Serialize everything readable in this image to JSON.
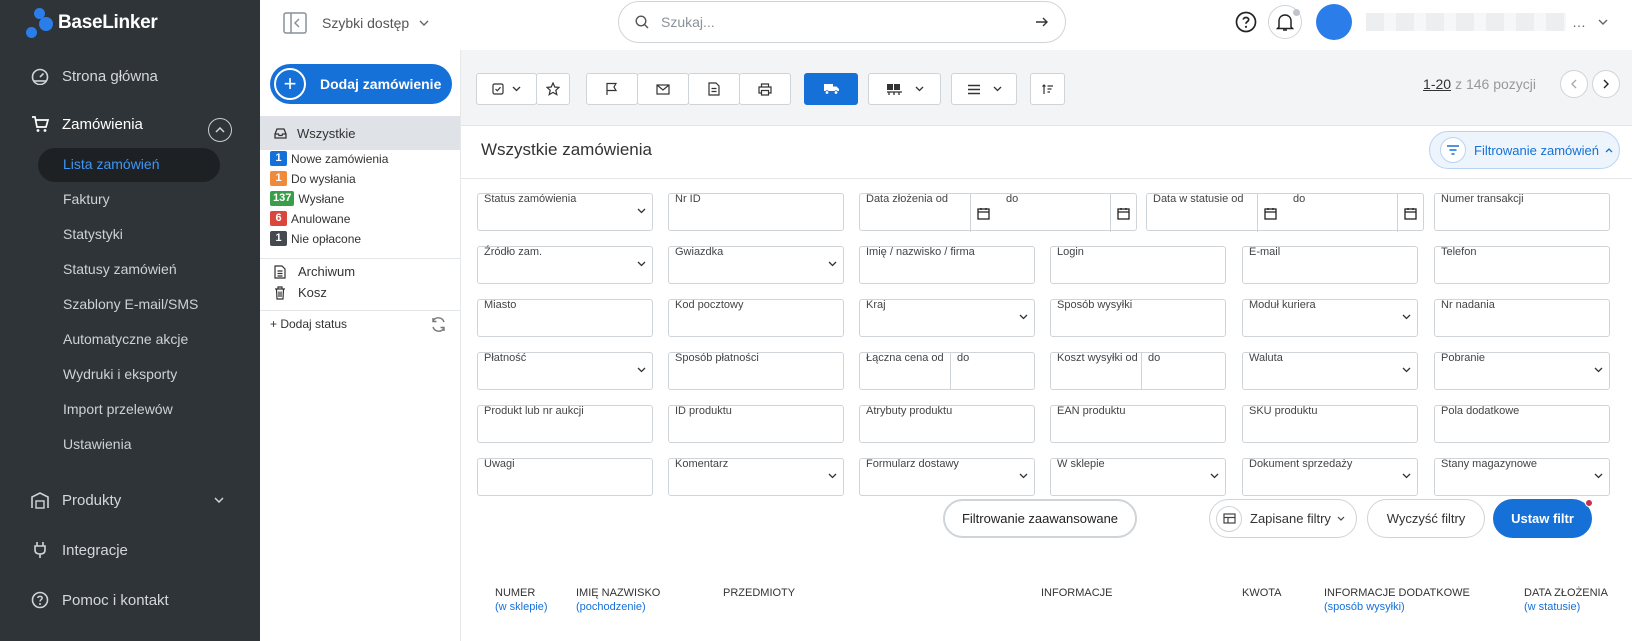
{
  "app": {
    "brand": "BaseLinker"
  },
  "sidebar": {
    "main_items": [
      {
        "label": "Strona główna",
        "icon": "dashboard-icon"
      },
      {
        "label": "Zamówienia",
        "icon": "cart-icon"
      },
      {
        "label": "Produkty",
        "icon": "warehouse-icon"
      },
      {
        "label": "Integracje",
        "icon": "plug-icon"
      },
      {
        "label": "Pomoc i kontakt",
        "icon": "help-icon"
      }
    ],
    "sub_items": [
      "Lista zamówień",
      "Faktury",
      "Statystyki",
      "Statusy zamówień",
      "Szablony E-mail/SMS",
      "Automatyczne akcje",
      "Wydruki i eksporty",
      "Import przelewów",
      "Ustawienia"
    ],
    "active_sub": "Lista zamówień"
  },
  "topbar": {
    "quick_access": "Szybki dostęp",
    "search_placeholder": "Szukaj...",
    "user_name_hidden": true
  },
  "statuses": {
    "add_order": "Dodaj zamówienie",
    "all": "Wszystkie",
    "items": [
      {
        "count": "1",
        "label": "Nowe zamówienia",
        "color": "#1570d8"
      },
      {
        "count": "1",
        "label": "Do wysłania",
        "color": "#ef8a3a"
      },
      {
        "count": "137",
        "label": "Wysłane",
        "color": "#3a9d49"
      },
      {
        "count": "6",
        "label": "Anulowane",
        "color": "#d9463b"
      },
      {
        "count": "1",
        "label": "Nie opłacone",
        "color": "#444a50"
      }
    ],
    "archive": "Archiwum",
    "trash": "Kosz",
    "add_status": "+ Dodaj status"
  },
  "pager": {
    "range": "1-20",
    "total": "z 146 pozycji"
  },
  "panel": {
    "title": "Wszystkie zamówienia",
    "filter_toggle": "Filtrowanie zamówień"
  },
  "filters": {
    "row1": {
      "status": "Status zamówienia",
      "nr_id": "Nr ID",
      "date_from": "Data złożenia od",
      "date_to": "do",
      "status_date_from": "Data w statusie od",
      "status_date_to": "do",
      "transaction": "Numer transakcji"
    },
    "row2": [
      "Źródło zam.",
      "Gwiazdka",
      "Imię / nazwisko / firma",
      "Login",
      "E-mail",
      "Telefon"
    ],
    "row3": [
      "Miasto",
      "Kod pocztowy",
      "Kraj",
      "Sposób wysyłki",
      "Moduł kuriera",
      "Nr nadania"
    ],
    "row4": {
      "payment": "Płatność",
      "payment_method": "Sposób płatności",
      "price_from": "Łączna cena od",
      "price_to": "do",
      "ship_cost_from": "Koszt wysyłki od",
      "ship_cost_to": "do",
      "currency": "Waluta",
      "cod": "Pobranie"
    },
    "row5": [
      "Produkt lub nr aukcji",
      "ID produktu",
      "Atrybuty produktu",
      "EAN produktu",
      "SKU produktu",
      "Pola dodatkowe"
    ],
    "row6": [
      "Uwagi",
      "Komentarz",
      "Formularz dostawy",
      "W sklepie",
      "Dokument sprzedaży",
      "Stany magazynowe"
    ]
  },
  "actions": {
    "advanced": "Filtrowanie zaawansowane",
    "saved": "Zapisane filtry",
    "clear": "Wyczyść filtry",
    "apply": "Ustaw filtr"
  },
  "table_headers": [
    {
      "label": "NUMER",
      "sub": "(w sklepie)"
    },
    {
      "label": "IMIĘ NAZWISKO",
      "sub": "(pochodzenie)"
    },
    {
      "label": "PRZEDMIOTY",
      "sub": ""
    },
    {
      "label": "INFORMACJE",
      "sub": ""
    },
    {
      "label": "KWOTA",
      "sub": ""
    },
    {
      "label": "INFORMACJE DODATKOWE",
      "sub": "(sposób wysyłki)"
    },
    {
      "label": "DATA ZŁOŻENIA",
      "sub": "(w statusie)"
    }
  ]
}
